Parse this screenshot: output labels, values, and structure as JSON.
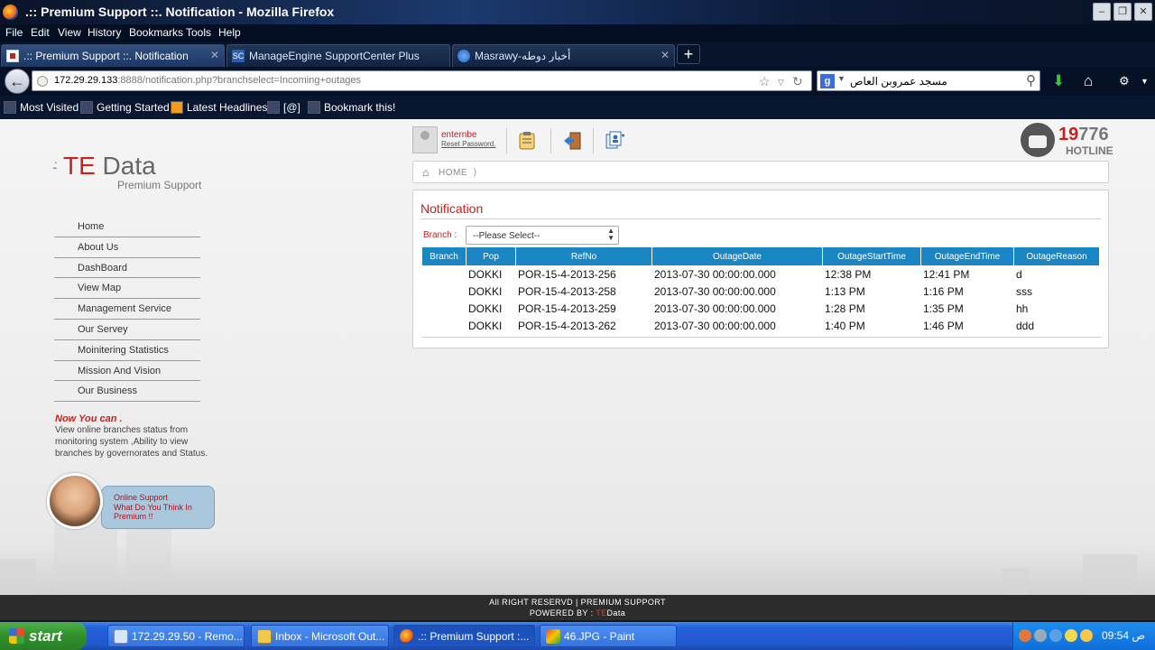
{
  "window": {
    "title": ".:: Premium Support ::. Notification - Mozilla Firefox"
  },
  "menubar": [
    "File",
    "Edit",
    "View",
    "History",
    "Bookmarks",
    "Tools",
    "Help"
  ],
  "tabs": [
    {
      "label": ".:: Premium Support ::. Notification",
      "active": true
    },
    {
      "label": "ManageEngine SupportCenter Plus",
      "active": false
    },
    {
      "label": "Masrawy-أخبار دوطه",
      "active": false
    }
  ],
  "navbar": {
    "url_host": "172.29.29.133",
    "url_rest": ":8888/notification.php?branchselect=Incoming+outages",
    "search_text": "مسجد عمروبن العاص"
  },
  "bookmarks": [
    "Most Visited",
    "Getting Started",
    "Latest Headlines",
    "[@]",
    "Bookmark this!"
  ],
  "page": {
    "logo": {
      "dots": ".:",
      "te": "TE",
      "data": " Data",
      "sub": "Premium Support"
    },
    "user": {
      "name": "enternbe",
      "reset": "Reset Password."
    },
    "hotline": {
      "num_a": "19",
      "num_b": "776",
      "label": "HOTLINE"
    },
    "breadcrumb": "HOME",
    "sidebar": [
      "Home",
      "About Us",
      "DashBoard",
      "View Map",
      "Management Service",
      "Our Servey",
      "Moinitering Statistics",
      "Mission And Vision",
      "Our Business"
    ],
    "now_you_can": {
      "title": "Now You can .",
      "desc": "View online branches status from monitoring system ,Ability to view branches by governorates and Status."
    },
    "online_support": {
      "title": "Online Support",
      "line": "What Do You Think In Premium !!"
    },
    "notification": {
      "title": "Notification",
      "branch_label": "Branch :",
      "branch_select": "--Please Select--",
      "columns": [
        "Branch",
        "Pop",
        "RefNo",
        "OutageDate",
        "OutageStartTime",
        "OutageEndTime",
        "OutageReason"
      ],
      "rows": [
        [
          "",
          "DOKKI",
          "POR-15-4-2013-256",
          "2013-07-30 00:00:00.000",
          "12:38 PM",
          "12:41 PM",
          "d"
        ],
        [
          "",
          "DOKKI",
          "POR-15-4-2013-258",
          "2013-07-30 00:00:00.000",
          "1:13 PM",
          "1:16 PM",
          "sss"
        ],
        [
          "",
          "DOKKI",
          "POR-15-4-2013-259",
          "2013-07-30 00:00:00.000",
          "1:28 PM",
          "1:35 PM",
          "hh"
        ],
        [
          "",
          "DOKKI",
          "POR-15-4-2013-262",
          "2013-07-30 00:00:00.000",
          "1:40 PM",
          "1:46 PM",
          "ddd"
        ]
      ]
    },
    "footer": {
      "line1": "All RIGHT RESERVD | PREMIUM SUPPORT",
      "powered": "POWERED BY : ",
      "te": "TE",
      "data": "Data"
    }
  },
  "taskbar": {
    "start": "start",
    "tasks": [
      {
        "label": "172.29.29.50 - Remo...",
        "active": false
      },
      {
        "label": "Inbox - Microsoft Out...",
        "active": false
      },
      {
        "label": ".:: Premium Support :...",
        "active": true
      },
      {
        "label": "46.JPG - Paint",
        "active": false
      }
    ],
    "clock": "09:54 ص"
  },
  "colors": {
    "brand_red": "#c8201c",
    "table_header": "#1a86c4"
  }
}
